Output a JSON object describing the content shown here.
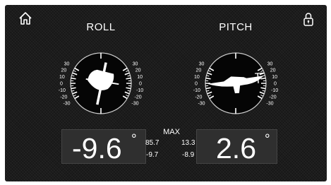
{
  "roll": {
    "title": "ROLL",
    "value": "-9.6",
    "unit": "°",
    "tick_labels_left": [
      "30",
      "20",
      "10",
      "0",
      "-10",
      "-20",
      "-30"
    ],
    "tick_labels_right": [
      "-30",
      "-20",
      "-10",
      "0",
      "10",
      "20",
      "30"
    ]
  },
  "pitch": {
    "title": "PITCH",
    "value": "2.6",
    "unit": "°",
    "tick_labels_left": [
      "30",
      "20",
      "10",
      "0",
      "-10",
      "-20",
      "-30"
    ],
    "tick_labels_right": [
      "-30",
      "-20",
      "-10",
      "0",
      "10",
      "20",
      "30"
    ]
  },
  "max": {
    "title": "MAX",
    "roll_max": "85.7",
    "roll_min": "-9.7",
    "pitch_max": "13.3",
    "pitch_min": "-8.9"
  },
  "icons": {
    "home": "home-icon",
    "lock": "lock-icon"
  },
  "colors": {
    "background": "#1c1c1c",
    "text": "#ffffff",
    "panel": "#2f2f2f",
    "boat": "#ffffff"
  }
}
